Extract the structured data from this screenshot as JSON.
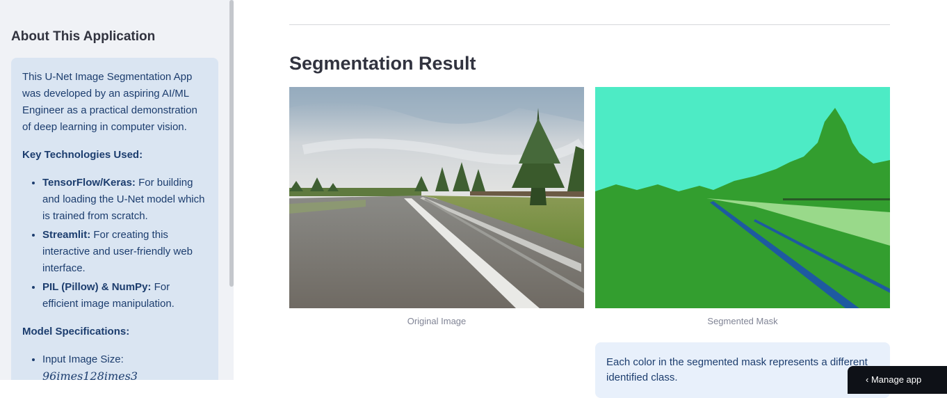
{
  "sidebar": {
    "title": "About This Application",
    "intro": "This U-Net Image Segmentation App was developed by an aspiring AI/ML Engineer as a practical demonstration of deep learning in computer vision.",
    "tech_heading": "Key Technologies Used:",
    "tech_items": [
      {
        "name": "TensorFlow/Keras:",
        "desc": " For building and loading the U-Net model which is trained from scratch."
      },
      {
        "name": "Streamlit:",
        "desc": " For creating this interactive and user-friendly web interface."
      },
      {
        "name": "PIL (Pillow) & NumPy:",
        "desc": " For efficient image manipulation."
      }
    ],
    "spec_heading": "Model Specifications:",
    "spec_items": [
      {
        "label": "Input Image Size:",
        "value": "96imes128imes3"
      }
    ]
  },
  "main": {
    "title": "Segmentation Result",
    "original_caption": "Original Image",
    "mask_caption": "Segmented Mask",
    "info_text": "Each color in the segmented mask represents a different identified class."
  },
  "manage_button": {
    "label": "Manage app",
    "icon": "chevron-left-icon"
  },
  "colors": {
    "sidebar_bg": "#f0f2f6",
    "info_bg": "#dae5f2",
    "info_text": "#1c3d6e",
    "mask_sky": "#4debc5",
    "mask_vegetation": "#339e2f",
    "mask_road_marking": "#99d98a",
    "mask_lane": "#1e5aa0"
  }
}
